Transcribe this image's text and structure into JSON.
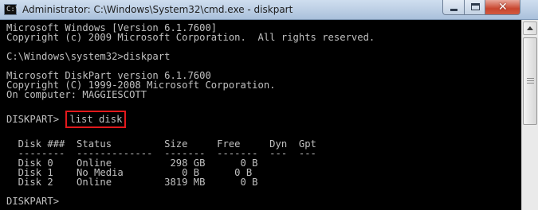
{
  "window": {
    "title": "Administrator: C:\\Windows\\System32\\cmd.exe - diskpart",
    "app_icon_glyph": "C:\\",
    "close_glyph": "✕"
  },
  "console": {
    "lines_before": [
      "Microsoft Windows [Version 6.1.7600]",
      "Copyright (c) 2009 Microsoft Corporation.  All rights reserved.",
      "",
      "C:\\Windows\\system32>diskpart",
      "",
      "Microsoft DiskPart version 6.1.7600",
      "Copyright (C) 1999-2008 Microsoft Corporation.",
      "On computer: MAGGIESCOTT",
      ""
    ],
    "prompt": "DISKPART> ",
    "command": "list disk",
    "lines_after": [
      "",
      "  Disk ###  Status         Size     Free     Dyn  Gpt",
      "  --------  -------------  -------  -------  ---  ---",
      "  Disk 0    Online          298 GB      0 B",
      "  Disk 1    No Media          0 B      0 B",
      "  Disk 2    Online         3819 MB      0 B",
      "",
      "DISKPART> "
    ]
  },
  "colors": {
    "console_bg": "#000000",
    "console_text": "#c0c0c0",
    "highlight_border": "#e2191c"
  },
  "icons": {
    "app": "cmd-app-icon",
    "minimize": "minimize-icon",
    "maximize": "maximize-icon",
    "close": "close-icon",
    "scroll_up": "scroll-up-arrow-icon"
  }
}
